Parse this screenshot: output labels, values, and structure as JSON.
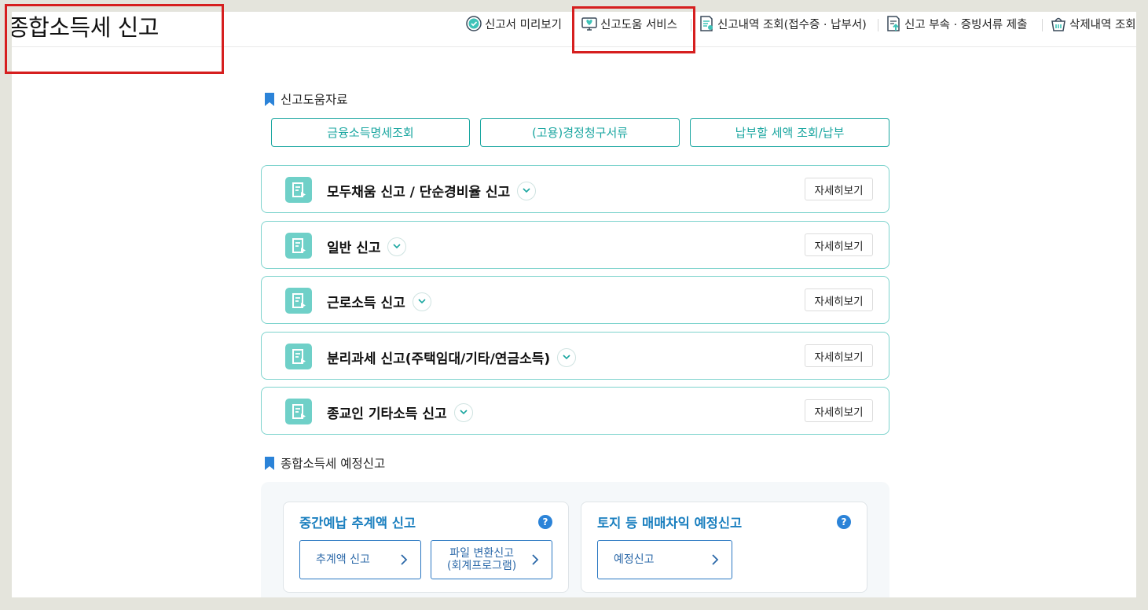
{
  "page_title": "종합소득세 신고",
  "top_nav": [
    {
      "label": "신고서 미리보기",
      "icon": "check-badge-icon"
    },
    {
      "label": "신고도움 서비스",
      "icon": "monitor-heart-icon"
    },
    {
      "label": "신고내역 조회(접수증 · 납부서)",
      "icon": "document-search-icon"
    },
    {
      "label": "신고 부속 · 증빙서류 제출",
      "icon": "document-upload-icon"
    },
    {
      "label": "삭제내역 조회",
      "icon": "trash-basket-icon"
    }
  ],
  "help_section": {
    "heading": "신고도움자료",
    "buttons": [
      "금융소득명세조회",
      "(고용)경정청구서류",
      "납부할 세액 조회/납부"
    ]
  },
  "filing_cards": [
    {
      "title": "모두채움 신고 / 단순경비율 신고",
      "detail": "자세히보기"
    },
    {
      "title": "일반 신고",
      "detail": "자세히보기"
    },
    {
      "title": "근로소득 신고",
      "detail": "자세히보기"
    },
    {
      "title": "분리과세 신고(주택임대/기타/연금소득)",
      "detail": "자세히보기"
    },
    {
      "title": "종교인 기타소득 신고",
      "detail": "자세히보기"
    }
  ],
  "preliminary_section": {
    "heading": "종합소득세 예정신고",
    "boxes": [
      {
        "title": "중간예납 추계액 신고",
        "help": "?",
        "buttons": [
          {
            "line1": "추계액 신고",
            "line2": ""
          },
          {
            "line1": "파일 변환신고",
            "line2": "(회계프로그램)"
          }
        ]
      },
      {
        "title": "토지 등 매매차익 예정신고",
        "help": "?",
        "buttons": [
          {
            "line1": "예정신고",
            "line2": ""
          }
        ]
      }
    ]
  },
  "colors": {
    "teal": "#1aa6a0",
    "card_border": "#7dd3cd",
    "card_icon": "#6fd0c8",
    "blue_title": "#1a7fbf",
    "bookmark": "#2b83d8",
    "highlight": "#d61f1f"
  }
}
